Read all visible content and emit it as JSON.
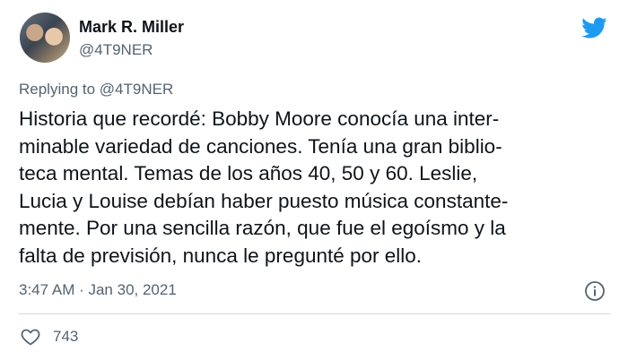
{
  "author": {
    "name": "Mark R. Miller",
    "handle": "@4T9NER"
  },
  "reply": {
    "prefix": "Replying to ",
    "mention": "@4T9NER"
  },
  "tweet_lines": [
    "Historia que recordé: Bobby Moore conocía una inter-",
    "minable variedad de canciones. Tenía una gran biblio-",
    "teca mental. Temas de los años 40, 50 y 60. Leslie,",
    "Lucia y Louise debían haber puesto música constante-",
    "mente. Por una sencilla razón, que fue el egoísmo y la",
    "falta de previsión, nunca le pregunté por ello."
  ],
  "meta": {
    "timestamp": "3:47 AM · Jan 30, 2021"
  },
  "engagement": {
    "likes": "743"
  },
  "icons": {
    "brand": "twitter-bird-icon",
    "info": "info-icon",
    "like": "heart-icon"
  },
  "colors": {
    "brand_blue": "#1d9bf0",
    "secondary_text": "#536471",
    "primary_text": "#0f1419"
  }
}
